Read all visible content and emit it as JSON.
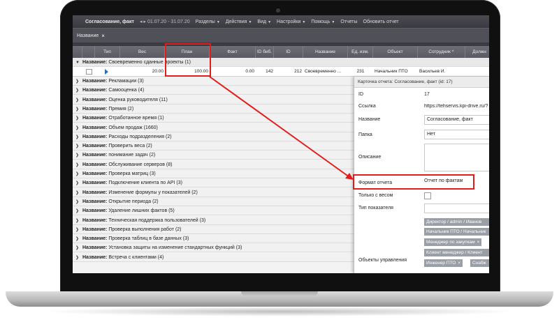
{
  "menubar": {
    "report_title": "Согласование, факт",
    "period_nav": "◂ ▸",
    "period": "01.07.20 - 31.07.20",
    "items": [
      {
        "label": "Разделы"
      },
      {
        "label": "Действия"
      },
      {
        "label": "Вид"
      },
      {
        "label": "Настройки"
      },
      {
        "label": "Помощь"
      },
      {
        "label": "Отчеты"
      },
      {
        "label": "Обновить отчет"
      }
    ]
  },
  "filter": {
    "label": "Название",
    "close": "×"
  },
  "table": {
    "columns": [
      "Тип",
      "Вес",
      "План",
      "Факт",
      "ID биб.",
      "ID",
      "Название",
      "Ед. изм.",
      "Объект",
      "Сотрудник",
      "Должн"
    ],
    "sort_indicator": "^",
    "group_label": "Название:",
    "first_group": "Своевременно сданные проекты (1)",
    "data_row": {
      "weight": "20.00",
      "plan": "100.00",
      "fact": "0.00",
      "lib_id": "142",
      "id": "212",
      "name": "Своевременно ...",
      "unit": "231",
      "object": "Начальник ПТО",
      "employee": "Васильев И."
    },
    "groups": [
      "Рекламации (3)",
      "Самооценка (4)",
      "Оценка руководителя (11)",
      "Премия (2)",
      "Отработанное время (1)",
      "Объем продаж (1660)",
      "Расходы подразделения (2)",
      "Проверить веса (2)",
      "понимание задач (2)",
      "Обслуживание серверов (8)",
      "Проверка матриц (3)",
      "Подключение клиента по API (3)",
      "Изменение формулы у показателей (2)",
      "Открытие периода (2)",
      "Удаление лишних фактов (5)",
      "Техническая поддержка пользователей (3)",
      "Проверка выполнения работ (2)",
      "Проверка таблиц в базе данных (3)",
      "Установка защиты на изменение стандартных функций (3)",
      "Встреча с клиентами (4)"
    ]
  },
  "card": {
    "title": "Карточка отчета: Согласование, факт (id: 17)",
    "fields": {
      "id_label": "ID",
      "id_value": "17",
      "link_label": "Ссылка",
      "link_value": "https://tehservis.kpi-drive.ru/?",
      "name_label": "Название",
      "name_value": "Согласование, факт",
      "folder_label": "Папка",
      "folder_value": "Нет",
      "desc_label": "Описание",
      "format_label": "Формат отчета",
      "format_value": "Отчет по фактам",
      "weight_only_label": "Только с весом",
      "indicator_type_label": "Тип показателя",
      "objects_label": "Объекты управления"
    },
    "tags": [
      "Директор / admin / Иванов",
      "Начальник ПТО / Начальник",
      "Менеджер по закупкам",
      "Клиент менеджер / Клиент",
      "Инженер ПТО",
      "Снабж"
    ],
    "tag_close": "×"
  },
  "colors": {
    "highlight": "#e21b1b",
    "tag_bg": "#9a9ea6",
    "menubar_bg": "#3a3a40"
  }
}
